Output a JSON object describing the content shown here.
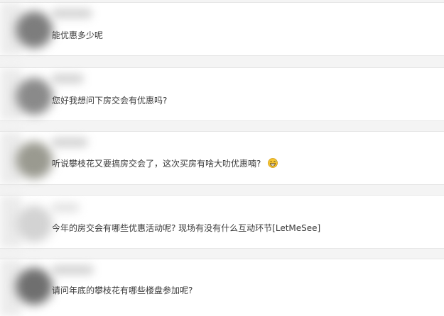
{
  "comments": [
    {
      "text": "能优惠多少呢",
      "avatar_color": "#7d7d7d"
    },
    {
      "text": "您好我想问下房交会有优惠吗?",
      "avatar_color": "#8a8a8a"
    },
    {
      "text": "听说攀枝花又要搞房交会了，这次买房有啥大叻优惠喃?",
      "avatar_color": "#9a9a90",
      "emoji": "grinning-face-sweat-emoji"
    },
    {
      "text": "今年的房交会有哪些优惠活动呢? 现场有没有什么互动环节[LetMeSee]",
      "avatar_color": "#d3d3d3"
    },
    {
      "text": "请问年底的攀枝花有哪些楼盘参加呢?",
      "avatar_color": "#6f6f6f"
    }
  ]
}
